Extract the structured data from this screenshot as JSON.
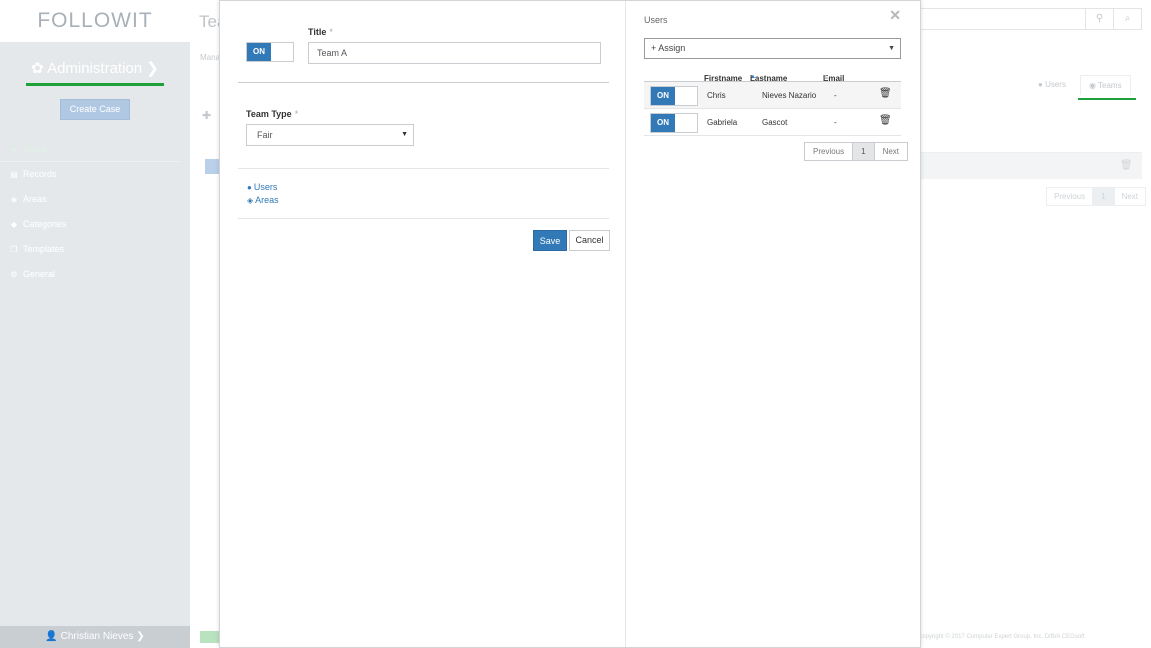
{
  "app": {
    "logo": "FOLLOWIT",
    "admin_title": "Administration",
    "create_case": "Create Case",
    "nav": [
      {
        "label": "Users",
        "icon": "user-icon"
      },
      {
        "label": "Records",
        "icon": "records-icon"
      },
      {
        "label": "Areas",
        "icon": "cube-icon"
      },
      {
        "label": "Categories",
        "icon": "tag-icon"
      },
      {
        "label": "Templates",
        "icon": "templates-icon"
      },
      {
        "label": "General",
        "icon": "gears-icon"
      }
    ],
    "user_name": "Christian Nieves",
    "page_title": "Tea",
    "page_sub": "Mana",
    "tabs": {
      "users": "Users",
      "teams": "Teams"
    },
    "bg_pager": {
      "prev": "Previous",
      "page": "1",
      "next": "Next"
    },
    "copyright": "Copyright © 2017 Computer Expert Group, Inc. D/B/A CEGsoft"
  },
  "modal": {
    "toggle_label": "ON",
    "title_label": "Title",
    "required_mark": "*",
    "title_value": "Team A",
    "team_type_label": "Team Type",
    "team_type_value": "Fair",
    "links": {
      "users": "Users",
      "areas": "Areas"
    },
    "save": "Save",
    "cancel": "Cancel",
    "users_panel": {
      "title": "Users",
      "assign": "+ Assign",
      "columns": {
        "firstname": "Firstname",
        "lastname": "Lastname",
        "email": "Email"
      },
      "rows": [
        {
          "on": "ON",
          "firstname": "Chris",
          "lastname": "Nieves Nazario",
          "email": "-"
        },
        {
          "on": "ON",
          "firstname": "Gabriela",
          "lastname": "Gascot",
          "email": "-"
        }
      ],
      "pager": {
        "prev": "Previous",
        "page": "1",
        "next": "Next"
      }
    }
  }
}
